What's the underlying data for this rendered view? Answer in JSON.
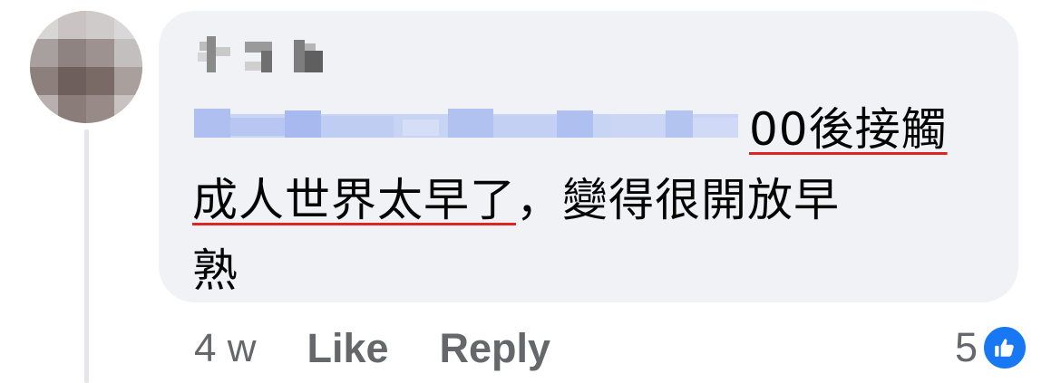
{
  "comment": {
    "text_line1": "00後接觸",
    "text_line2_underlined": "成人世界太早了",
    "text_line2_rest": "，變得很開放早",
    "text_line3": "熟"
  },
  "actions": {
    "timestamp": "4 w",
    "like_label": "Like",
    "reply_label": "Reply"
  },
  "reactions": {
    "count": "5",
    "icon": "thumbs-up-icon",
    "badge_color": "#1877f2"
  },
  "colors": {
    "bubble": "#f0f2f5",
    "underline": "#e02424",
    "secondary_text": "#65676b"
  }
}
